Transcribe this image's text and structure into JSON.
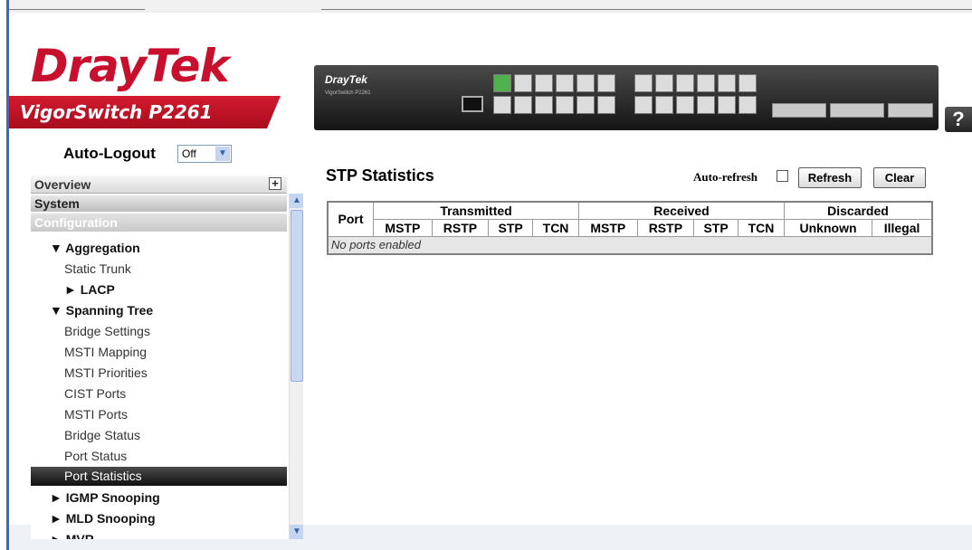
{
  "header": {
    "logo": "DrayTek",
    "model": "VigorSwitch P2261",
    "device_brand": "DrayTek",
    "device_subtitle": "VigorSwitch P2261",
    "help": "?"
  },
  "sidebar": {
    "autologout_label": "Auto-Logout",
    "autologout_value": "Off",
    "overview": "Overview",
    "system": "System",
    "configuration": "Configuration",
    "items": [
      {
        "label": "▼ Aggregation",
        "level": 1
      },
      {
        "label": "Static Trunk",
        "level": 2
      },
      {
        "label": "► LACP",
        "level": 2
      },
      {
        "label": "▼ Spanning Tree",
        "level": 1
      },
      {
        "label": "Bridge Settings",
        "level": 2
      },
      {
        "label": "MSTI Mapping",
        "level": 2
      },
      {
        "label": "MSTI Priorities",
        "level": 2
      },
      {
        "label": "CIST Ports",
        "level": 2
      },
      {
        "label": "MSTI Ports",
        "level": 2
      },
      {
        "label": "Bridge Status",
        "level": 2
      },
      {
        "label": "Port Status",
        "level": 2
      },
      {
        "label": "Port Statistics",
        "level": 2,
        "active": true
      },
      {
        "label": "► IGMP Snooping",
        "level": 1
      },
      {
        "label": "► MLD Snooping",
        "level": 1
      },
      {
        "label": "► MVR",
        "level": 1
      }
    ]
  },
  "main": {
    "title": "STP Statistics",
    "auto_refresh_label": "Auto-refresh",
    "refresh_label": "Refresh",
    "clear_label": "Clear",
    "table": {
      "port_header": "Port",
      "groups": [
        "Transmitted",
        "Received",
        "Discarded"
      ],
      "columns": [
        "MSTP",
        "RSTP",
        "STP",
        "TCN",
        "MSTP",
        "RSTP",
        "STP",
        "TCN",
        "Unknown",
        "Illegal"
      ],
      "empty_message": "No ports enabled"
    }
  }
}
